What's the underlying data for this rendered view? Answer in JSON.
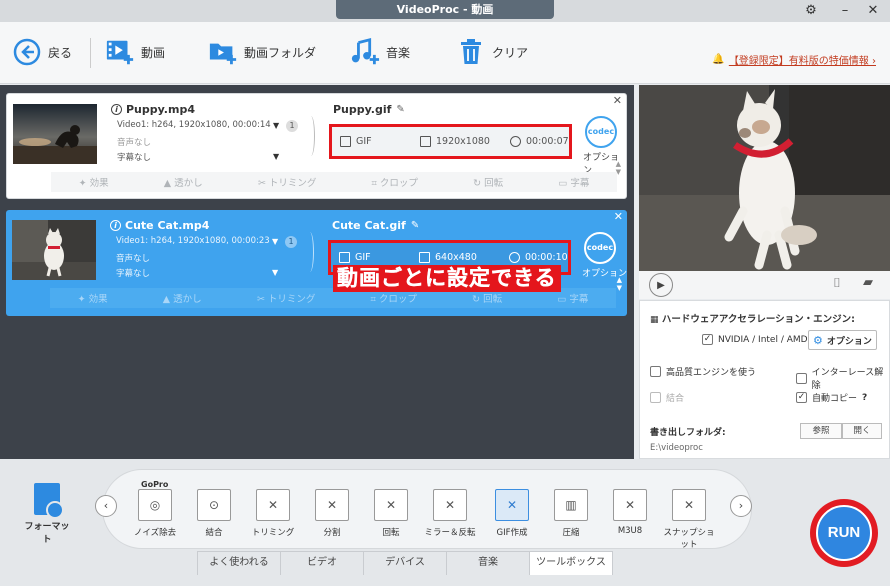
{
  "window": {
    "title": "VideoProc - 動画"
  },
  "toolbar": {
    "back": "戻る",
    "video": "動画",
    "video_folder": "動画フォルダ",
    "music": "音楽",
    "clear": "クリア",
    "notice": "【登録限定】有料版の特価情報 ›"
  },
  "items": [
    {
      "name": "Puppy.mp4",
      "video_info": "Video1: h264, 1920x1080, 00:00:14",
      "audio": "音声なし",
      "subtitle": "字幕なし",
      "badge": "1",
      "output_name": "Puppy.gif",
      "format": "GIF",
      "resolution": "1920x1080",
      "duration": "00:00:07",
      "option_label": "オプション",
      "codec_label": "codec"
    },
    {
      "name": "Cute Cat.mp4",
      "video_info": "Video1: h264, 1920x1080, 00:00:23",
      "audio": "音声なし",
      "subtitle": "字幕なし",
      "badge": "1",
      "output_name": "Cute Cat.gif",
      "format": "GIF",
      "resolution": "640x480",
      "duration": "00:00:10",
      "option_label": "オプション",
      "codec_label": "codec"
    }
  ],
  "edit_tools": {
    "effect": "効果",
    "watermark": "透かし",
    "trim": "トリミング",
    "crop": "クロップ",
    "rotate": "回転",
    "subtitle": "字幕"
  },
  "overlay_caption": "動画ごとに設定できる",
  "settings": {
    "hw_title": "ハードウェアアクセラレーション・エンジン:",
    "gpu": "NVIDIA / Intel / AMD",
    "option_button": "オプション",
    "high_quality": "高品質エンジンを使う",
    "deinterlace": "インターレース解除",
    "merge": "結合",
    "auto_copy": "自動コピー",
    "help": "?",
    "output_folder_title": "書き出しフォルダ:",
    "output_path": "E:\\videoproc",
    "browse": "参照",
    "open": "開く"
  },
  "bottom": {
    "format": "フォーマット",
    "gopro": "GoPro",
    "tools": [
      {
        "label": "ノイズ除去"
      },
      {
        "label": "結合"
      },
      {
        "label": "トリミング"
      },
      {
        "label": "分割"
      },
      {
        "label": "回転"
      },
      {
        "label": "ミラー＆反転"
      },
      {
        "label": "GIF作成"
      },
      {
        "label": "圧縮"
      },
      {
        "label": "M3U8"
      },
      {
        "label": "スナップショット"
      }
    ],
    "tabs": [
      "よく使われる",
      "ビデオ",
      "デバイス",
      "音楽",
      "ツールボックス"
    ],
    "run": "RUN"
  },
  "colors": {
    "accent": "#3fa3ee",
    "highlight_red": "#e4161c",
    "run_blue": "#2f86e0"
  }
}
